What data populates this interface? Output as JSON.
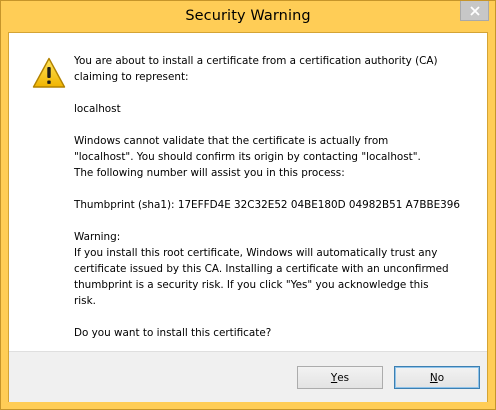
{
  "window": {
    "title": "Security Warning",
    "close_glyph": "✕"
  },
  "icon": {
    "name": "warning-icon",
    "fill_color": "#f5c41a",
    "stroke_color": "#b28200"
  },
  "message": {
    "intro_line1": "You are about to install a certificate from a certification authority (CA)",
    "intro_line2": "claiming to represent:",
    "subject": "localhost",
    "validate_line1": "Windows cannot validate that the certificate is actually from",
    "validate_line2": "\"localhost\". You should confirm its origin by contacting \"localhost\".",
    "validate_line3": "The following number will assist you in this process:",
    "thumbprint": "Thumbprint (sha1): 17EFFD4E 32C32E52 04BE180D 04982B51 A7BBE396",
    "warning_heading": "Warning:",
    "warning_line1": "If you install this root certificate, Windows will automatically trust any",
    "warning_line2": "certificate issued by this CA. Installing a certificate with an unconfirmed",
    "warning_line3": "thumbprint is a security risk. If you click \"Yes\" you acknowledge this",
    "warning_line4": "risk.",
    "question": "Do you want to install this certificate?"
  },
  "buttons": {
    "yes_mnemonic": "Y",
    "yes_rest": "es",
    "no_mnemonic": "N",
    "no_rest": "o"
  }
}
